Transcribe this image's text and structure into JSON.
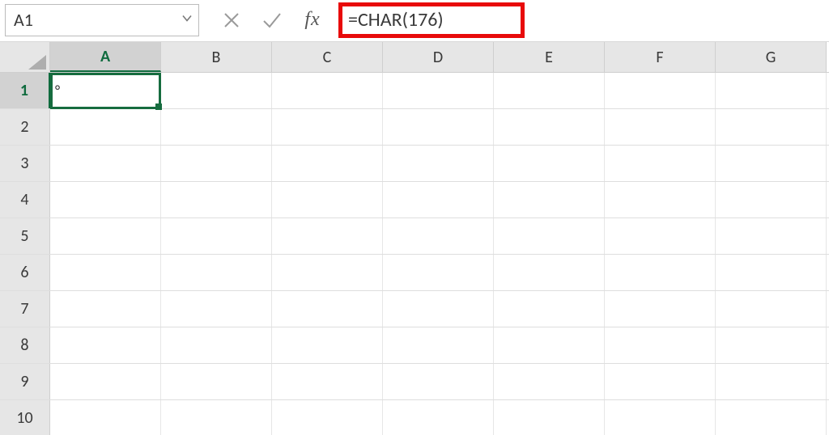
{
  "name_box": {
    "value": "A1"
  },
  "formula_bar": {
    "cancel_title": "Cancel",
    "enter_title": "Enter",
    "fx_label": "fx",
    "formula": "=CHAR(176)"
  },
  "columns": [
    "A",
    "B",
    "C",
    "D",
    "E",
    "F",
    "G"
  ],
  "rows": [
    "1",
    "2",
    "3",
    "4",
    "5",
    "6",
    "7",
    "8",
    "9",
    "10"
  ],
  "selected": {
    "col_index": 0,
    "row_index": 0
  },
  "cells": {
    "A1": "°"
  },
  "colors": {
    "selection_green": "#166c3f",
    "highlight_red": "#e80a0a",
    "header_bg": "#e6e6e6"
  }
}
